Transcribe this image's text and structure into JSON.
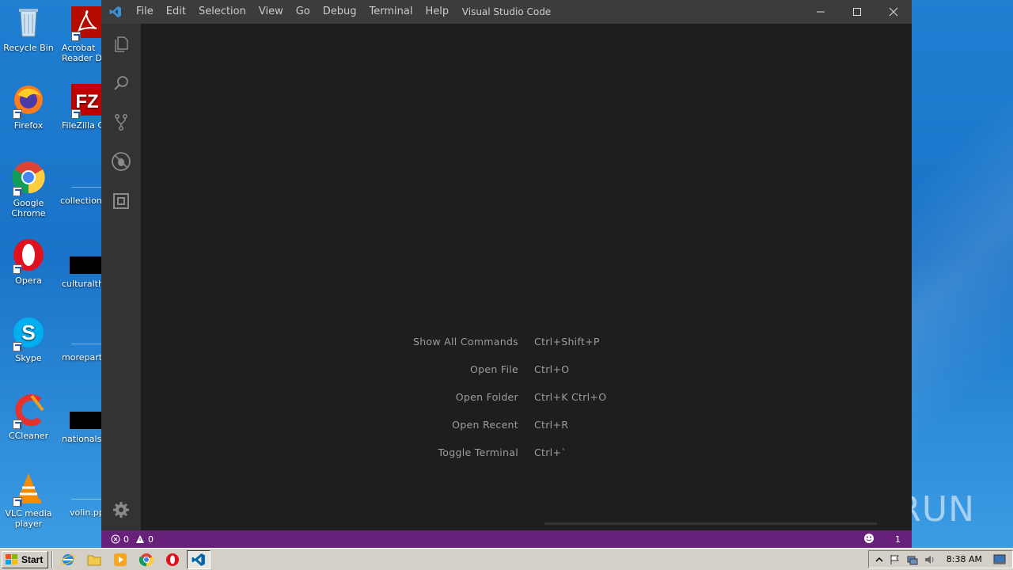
{
  "desktop": {
    "col1": [
      {
        "label": "Recycle Bin",
        "icon": "recycle-bin-icon"
      },
      {
        "label": "Firefox",
        "icon": "firefox-icon"
      },
      {
        "label": "Google Chrome",
        "icon": "chrome-icon"
      },
      {
        "label": "Opera",
        "icon": "opera-icon"
      },
      {
        "label": "Skype",
        "icon": "skype-icon"
      },
      {
        "label": "CCleaner",
        "icon": "ccleaner-icon"
      },
      {
        "label": "VLC media player",
        "icon": "vlc-icon"
      }
    ],
    "col2": [
      {
        "label": "Acrobat Reader D",
        "icon": "acrobat-icon"
      },
      {
        "label": "FileZilla Cli",
        "icon": "filezilla-icon"
      },
      {
        "label": "collectionas",
        "icon": "file-icon"
      },
      {
        "label": "culturalthi",
        "icon": "file-icon"
      },
      {
        "label": "moreparty",
        "icon": "file-icon"
      },
      {
        "label": "nationalst",
        "icon": "file-icon"
      },
      {
        "label": "volin.pp",
        "icon": "file-icon"
      }
    ],
    "watermark": "ANY RUN"
  },
  "window": {
    "title": "Visual Studio Code",
    "menu": [
      "File",
      "Edit",
      "Selection",
      "View",
      "Go",
      "Debug",
      "Terminal",
      "Help"
    ]
  },
  "activity": [
    "files-icon",
    "search-icon",
    "source-control-icon",
    "debug-icon",
    "extensions-icon",
    "gear-icon"
  ],
  "shortcuts": [
    {
      "label": "Show All Commands",
      "key": "Ctrl+Shift+P"
    },
    {
      "label": "Open File",
      "key": "Ctrl+O"
    },
    {
      "label": "Open Folder",
      "key": "Ctrl+K Ctrl+O"
    },
    {
      "label": "Open Recent",
      "key": "Ctrl+R"
    },
    {
      "label": "Toggle Terminal",
      "key": "Ctrl+`"
    }
  ],
  "status": {
    "errors": "0",
    "warnings": "0",
    "notifications": "1",
    "color": "#68217a"
  },
  "taskbar": {
    "start": "Start",
    "time": "8:38 AM"
  }
}
